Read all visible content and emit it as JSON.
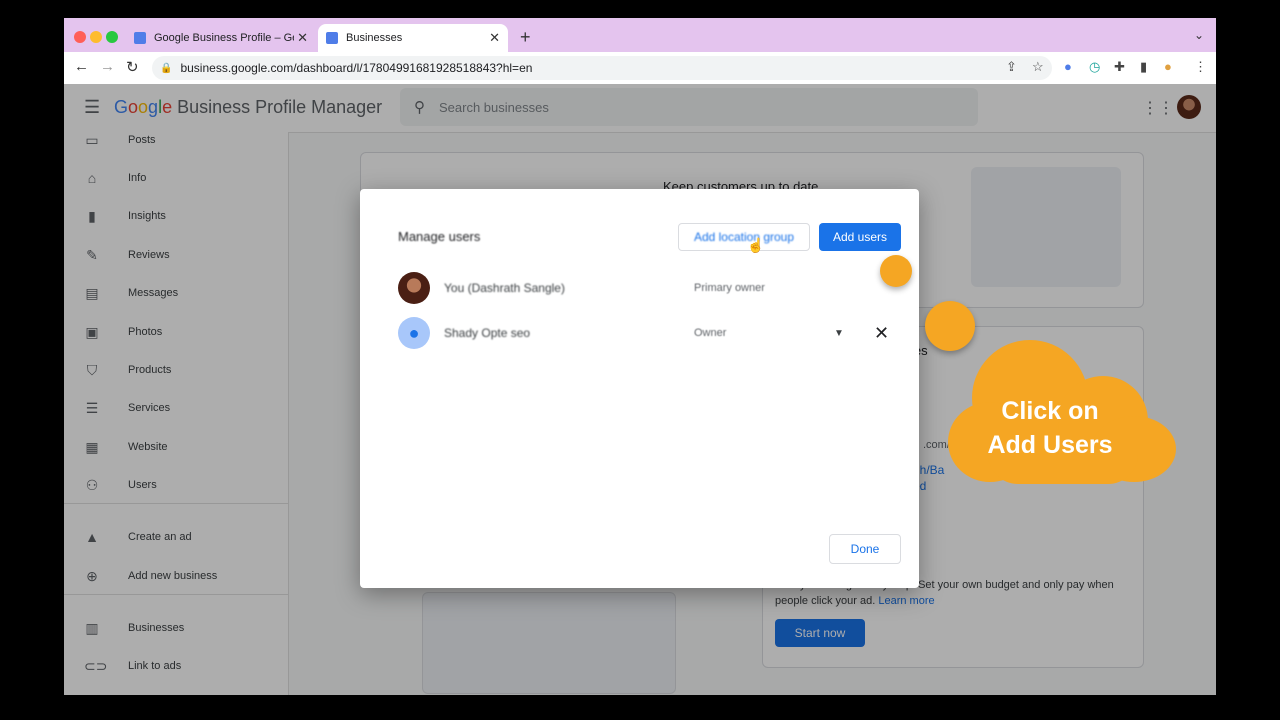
{
  "browser": {
    "tabs": [
      {
        "title": "Google Business Profile – Get l",
        "active": false
      },
      {
        "title": "Businesses",
        "active": true
      }
    ],
    "url": "business.google.com/dashboard/l/17804991681928518843?hl=en"
  },
  "header": {
    "logo_google": [
      "G",
      "o",
      "o",
      "g",
      "l",
      "e"
    ],
    "logo_rest": " Business Profile Manager",
    "search_placeholder": "Search businesses"
  },
  "sidebar": {
    "items": [
      {
        "label": "Posts",
        "icon": "posts-icon"
      },
      {
        "label": "Info",
        "icon": "store-icon"
      },
      {
        "label": "Insights",
        "icon": "bar-chart-icon"
      },
      {
        "label": "Reviews",
        "icon": "reviews-icon"
      },
      {
        "label": "Messages",
        "icon": "message-icon"
      },
      {
        "label": "Photos",
        "icon": "photos-icon"
      },
      {
        "label": "Products",
        "icon": "basket-icon"
      },
      {
        "label": "Services",
        "icon": "list-icon"
      },
      {
        "label": "Website",
        "icon": "website-icon"
      },
      {
        "label": "Users",
        "icon": "add-user-icon"
      },
      {
        "label": "Create an ad",
        "icon": "ads-icon"
      },
      {
        "label": "Add new business",
        "icon": "add-location-icon"
      },
      {
        "label": "Businesses",
        "icon": "businesses-icon"
      },
      {
        "label": "Link to ads",
        "icon": "link-icon"
      }
    ]
  },
  "background": {
    "card_title": "Keep customers up to date",
    "card2_fragment": "utes",
    "link_fragment_1": ".com/",
    "link_fragment_2": "dh/Ba",
    "link_fragment_3": "ed",
    "ad_text": "walk you through every step. Set your own budget and only pay when people click your ad.",
    "learn_more": "Learn more",
    "start_now": "Start now"
  },
  "dialog": {
    "title": "Manage users",
    "add_location_group": "Add location group",
    "add_users": "Add users",
    "users": [
      {
        "name": "You (Dashrath Sangle)",
        "role": "Primary owner",
        "removable": false
      },
      {
        "name": "Shady Opte seo",
        "role": "Owner",
        "removable": true
      }
    ],
    "done": "Done"
  },
  "callout": {
    "line1": "Click on",
    "line2": "Add Users"
  },
  "colors": {
    "accent": "#1a73e8",
    "callout": "#f5a623",
    "tabbar": "#e4c4ee"
  }
}
